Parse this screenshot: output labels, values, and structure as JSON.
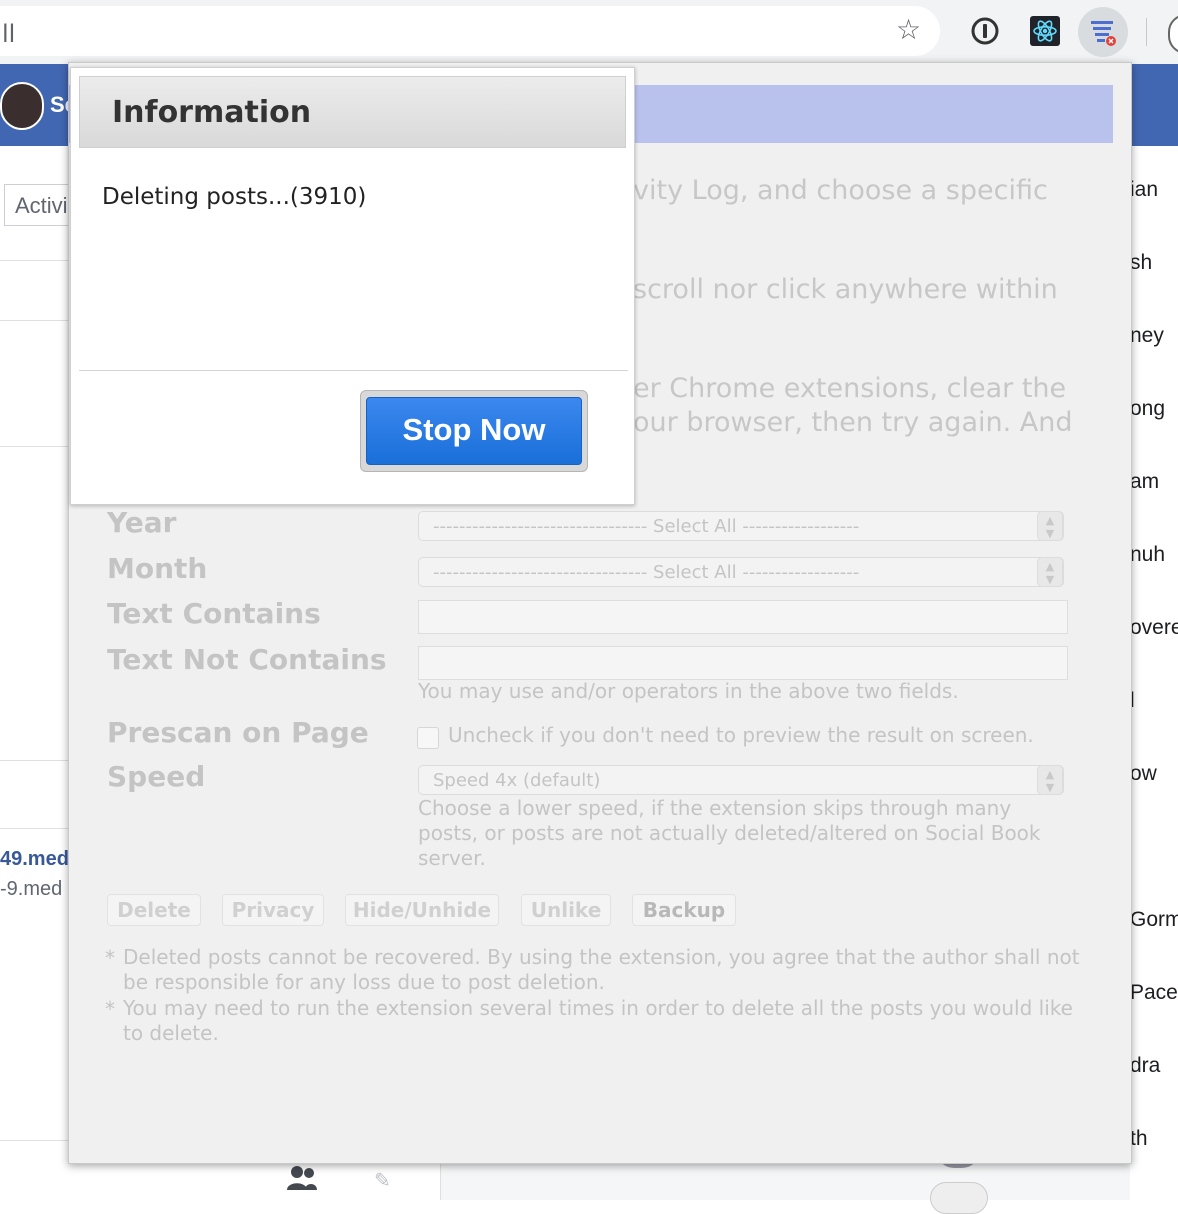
{
  "browser": {
    "url_text": "ll",
    "star_glyph": "☆",
    "extension_icons": [
      "onepassword-icon",
      "react-devtools-icon",
      "social-book-post-manager-icon"
    ]
  },
  "facebook": {
    "profile_name_partial": "Se",
    "activity_button_partial": "Activi",
    "link_partial_1": "49.med",
    "link_partial_2": "-9.med",
    "contacts": [
      "ian",
      "sh",
      "ney",
      "ong",
      "am",
      "nuh",
      "overe",
      "l",
      "ow",
      "Gorma",
      "Pace",
      "dra",
      "th"
    ],
    "brand_color": "#4267b2"
  },
  "extension": {
    "instructions": [
      "vity Log, and choose a specific",
      "scroll nor click anywhere within",
      "er Chrome extensions, clear the",
      "our browser, then try again. And"
    ],
    "labels": {
      "year": "Year",
      "month": "Month",
      "text_contains": "Text Contains",
      "text_not_contains": "Text Not Contains",
      "prescan": "Prescan on Page",
      "speed": "Speed"
    },
    "year_select": "--------------------------------- Select All ------------------",
    "month_select": "--------------------------------- Select All ------------------",
    "text_contains_value": "",
    "text_not_contains_value": "",
    "operators_hint": "You may use and/or operators in the above two fields.",
    "prescan_hint": "Uncheck if you don't need to preview the result on screen.",
    "speed_select": "Speed 4x (default)",
    "speed_hint": [
      "Choose a lower speed, if the extension skips through many",
      "posts, or posts are not actually deleted/altered on Social Book",
      "server."
    ],
    "buttons": {
      "delete": "Delete",
      "privacy": "Privacy",
      "hide_unhide": "Hide/Unhide",
      "unlike": "Unlike",
      "backup": "Backup"
    },
    "notes": [
      [
        "Deleted posts cannot be recovered. By using the extension, you agree that the author shall not",
        "be responsible for any loss due to post deletion."
      ],
      [
        "You may need to run the extension several times in order to delete all the posts you would like",
        "to delete."
      ]
    ],
    "note_bullet": "*"
  },
  "dialog": {
    "title": "Information",
    "message": "Deleting posts...(3910)",
    "stop_label": "Stop Now",
    "stop_color": "#2a7be4"
  }
}
